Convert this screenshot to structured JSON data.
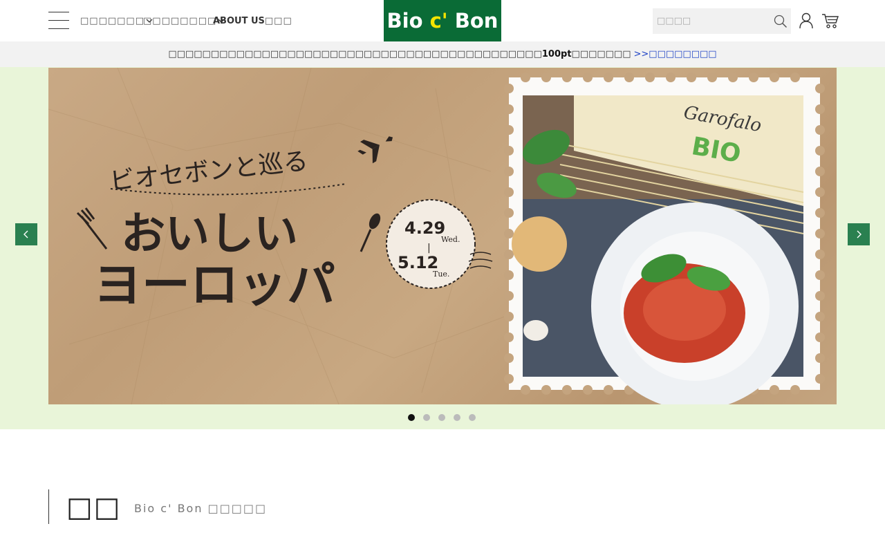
{
  "header": {
    "nav": [
      {
        "label": "□□□□□□□"
      },
      {
        "label": "□□□□□□□□"
      },
      {
        "label_bold": "ABOUT US",
        "label_rest": "□□□"
      }
    ],
    "logo": {
      "part1": "Bio ",
      "part2": "c'",
      "part3": " Bon"
    },
    "search": {
      "placeholder": "□□□□"
    }
  },
  "notice": {
    "text": "□□□□□□□□□□□□□□□□□□□□□□□□□□□□□□□□□□□□□□□□□□□□",
    "bold": "100pt",
    "after": "□□□□□□□",
    "link": ">>□□□□□□□□"
  },
  "hero": {
    "banner": {
      "title_line1": "ビオセボンと巡る",
      "title_line2": "おいしい",
      "title_line3": "ヨーロッパ",
      "date_start": "4.29",
      "date_start_day": "Wed.",
      "date_sep": "|",
      "date_end": "5.12",
      "date_end_day": "Tue.",
      "pasta_brand": "Garofalo",
      "pasta_label": "BIO"
    },
    "slide_count": 5,
    "active_slide": 0
  },
  "section": {
    "title": "□□",
    "subtitle": "Bio c' Bon □□□□□"
  },
  "colors": {
    "brand_green": "#0a6b36",
    "brand_yellow": "#f5e400",
    "hero_bg": "#e9f5d9",
    "arrow_bg": "#2a8050",
    "link_blue": "#1a3fc4"
  }
}
